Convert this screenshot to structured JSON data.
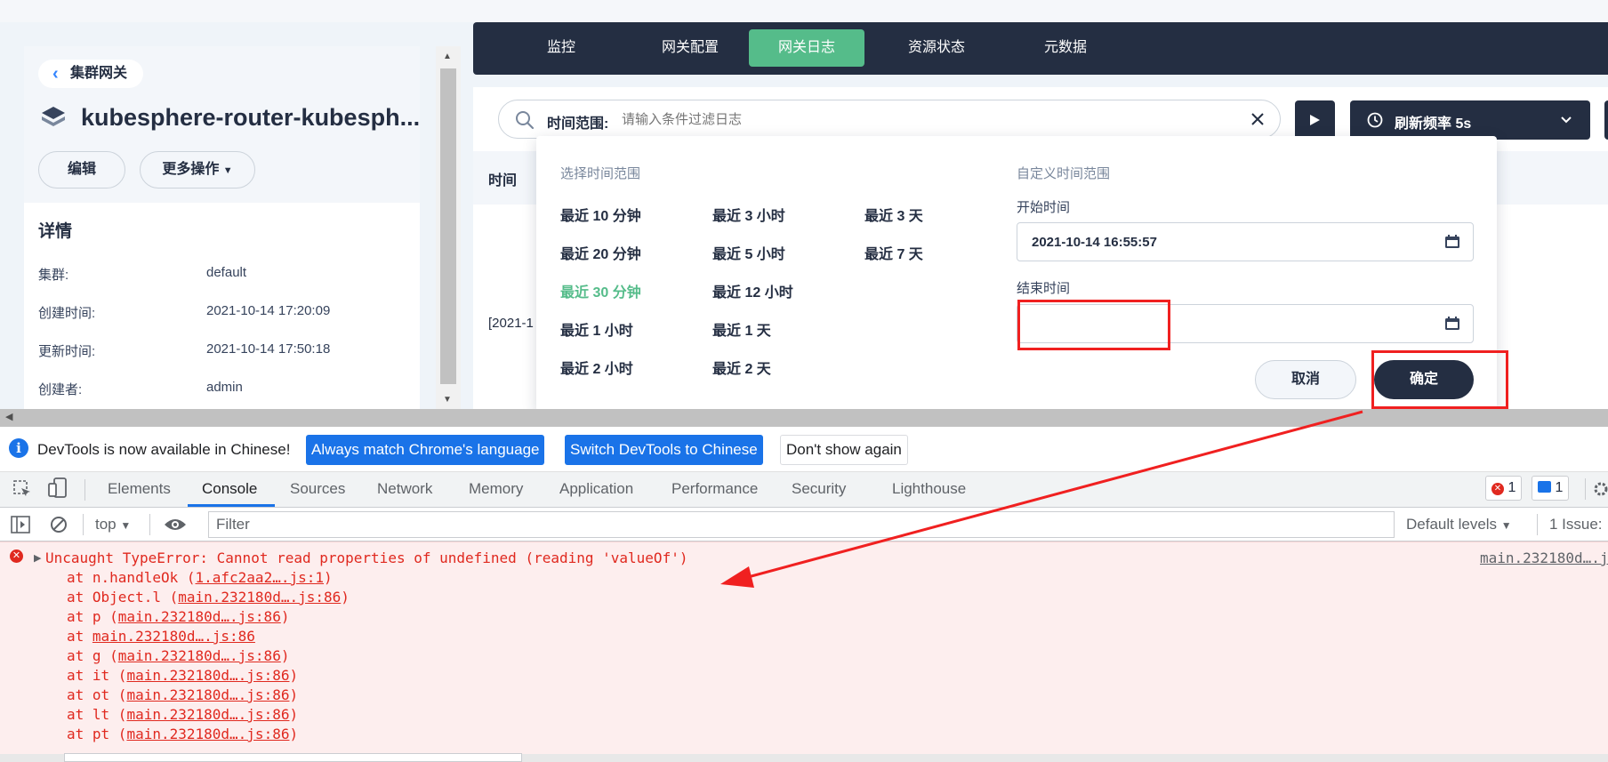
{
  "app": {
    "back_label": "集群网关",
    "gateway_name": "kubesphere-router-kubesph...",
    "edit_label": "编辑",
    "more_actions_label": "更多操作",
    "details_title": "详情",
    "details": [
      {
        "key": "集群:",
        "value": "default"
      },
      {
        "key": "创建时间:",
        "value": "2021-10-14 17:20:09"
      },
      {
        "key": "更新时间:",
        "value": "2021-10-14 17:50:18"
      },
      {
        "key": "创建者:",
        "value": "admin"
      }
    ],
    "tabs": [
      {
        "label": "监控",
        "active": false
      },
      {
        "label": "网关配置",
        "active": false
      },
      {
        "label": "网关日志",
        "active": true
      },
      {
        "label": "资源状态",
        "active": false
      },
      {
        "label": "元数据",
        "active": false
      }
    ],
    "search_label": "时间范围:",
    "search_placeholder": "请输入条件过滤日志",
    "refresh_label": "刷新频率 5s",
    "table_header_time": "时间",
    "log_row_prefix": "[2021-1"
  },
  "time_picker": {
    "quick_caption": "选择时间范围",
    "custom_caption": "自定义时间范围",
    "quick_ranges": [
      [
        "最近 10 分钟",
        "最近 20 分钟",
        "最近 30 分钟",
        "最近 1 小时",
        "最近 2 小时"
      ],
      [
        "最近 3 小时",
        "最近 5 小时",
        "最近 12 小时",
        "最近 1 天",
        "最近 2 天"
      ],
      [
        "最近 3 天",
        "最近 7 天"
      ]
    ],
    "active_range": "最近 30 分钟",
    "start_label": "开始时间",
    "start_value": "2021-10-14 16:55:57",
    "end_label": "结束时间",
    "end_value": "",
    "cancel_label": "取消",
    "ok_label": "确定"
  },
  "devtools": {
    "info_text": "DevTools is now available in Chinese!",
    "btn_match": "Always match Chrome's language",
    "btn_switch": "Switch DevTools to Chinese",
    "btn_dismiss": "Don't show again",
    "tabs": [
      "Elements",
      "Console",
      "Sources",
      "Network",
      "Memory",
      "Application",
      "Performance",
      "Security",
      "Lighthouse"
    ],
    "active_tab": "Console",
    "error_count": "1",
    "message_count": "1",
    "context": "top",
    "filter_placeholder": "Filter",
    "levels": "Default levels",
    "issues": "1 Issue:",
    "error_message": "Uncaught TypeError: Cannot read properties of undefined (reading 'valueOf')",
    "error_source": "main.232180d….j",
    "stack": [
      {
        "fn": "at n.handleOk (",
        "link": "1.afc2aa2….js:1",
        "end": ")"
      },
      {
        "fn": "at Object.l (",
        "link": "main.232180d….js:86",
        "end": ")"
      },
      {
        "fn": "at p (",
        "link": "main.232180d….js:86",
        "end": ")"
      },
      {
        "fn": "at ",
        "link": "main.232180d….js:86",
        "end": ""
      },
      {
        "fn": "at g (",
        "link": "main.232180d….js:86",
        "end": ")"
      },
      {
        "fn": "at it (",
        "link": "main.232180d….js:86",
        "end": ")"
      },
      {
        "fn": "at ot (",
        "link": "main.232180d….js:86",
        "end": ")"
      },
      {
        "fn": "at lt (",
        "link": "main.232180d….js:86",
        "end": ")"
      },
      {
        "fn": "at pt (",
        "link": "main.232180d….js:86",
        "end": ")"
      }
    ]
  },
  "colors": {
    "accent_green": "#55bc8a",
    "dark_navy": "#242e42",
    "error_red": "#e0291f",
    "annotation_red": "#f02020"
  }
}
